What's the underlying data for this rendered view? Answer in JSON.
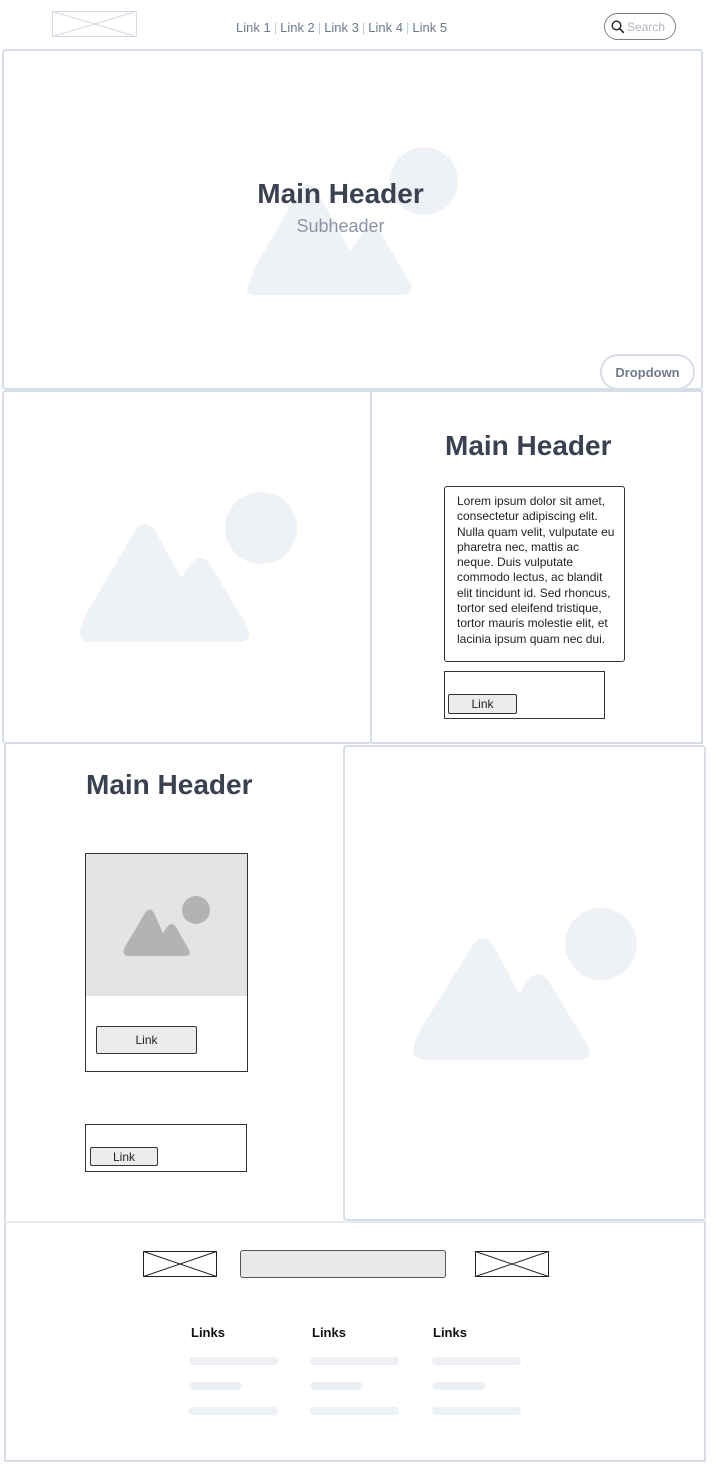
{
  "nav": {
    "links": [
      "Link 1",
      "Link 2",
      "Link 3",
      "Link 4",
      "Link 5"
    ],
    "search_placeholder": "Search"
  },
  "hero": {
    "title": "Main Header",
    "subtitle": "Subheader",
    "dropdown_label": "Dropdown"
  },
  "section2": {
    "title": "Main Header",
    "body": "Lorem ipsum dolor sit amet, consectetur adipiscing elit. Nulla quam velit, vulputate eu pharetra nec, mattis ac neque. Duis vulputate commodo lectus, ac blandit elit tincidunt id. Sed rhoncus, tortor sed eleifend tristique, tortor mauris molestie elit, et lacinia ipsum quam nec dui.",
    "link_label": "Link"
  },
  "section3": {
    "title": "Main Header",
    "card_link_label": "Link",
    "link_label": "Link"
  },
  "footer": {
    "columns": [
      {
        "title": "Links"
      },
      {
        "title": "Links"
      },
      {
        "title": "Links"
      }
    ]
  },
  "colors": {
    "placeholder_shape": "#eef1f5",
    "frame_border": "#d7dee7",
    "heading": "#3a4150"
  }
}
